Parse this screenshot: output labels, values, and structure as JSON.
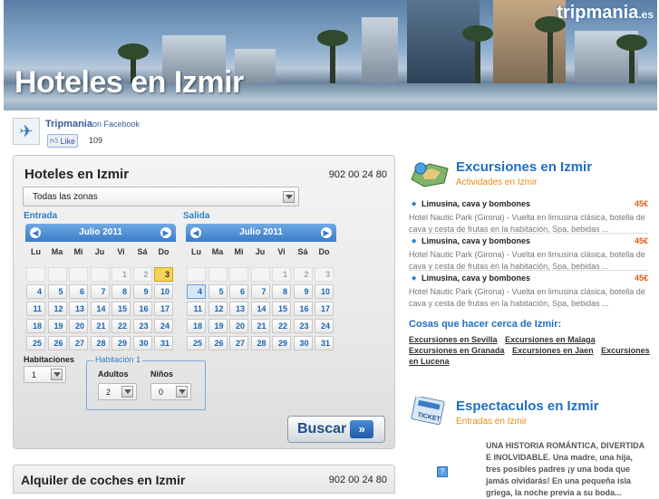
{
  "header": {
    "title": "Hoteles en Izmir",
    "logo_name": "tripmania",
    "logo_tld": ".es"
  },
  "facebook": {
    "page_name": "Tripmania",
    "on_text": "on Facebook",
    "like_label": "Like",
    "like_count": "109"
  },
  "hotels": {
    "title": "Hoteles en Izmir",
    "phone": "902 00 24 80",
    "zone_value": "Todas las zonas",
    "entrada_label": "Entrada",
    "salida_label": "Salida",
    "weekdays": [
      "Lu",
      "Ma",
      "Mi",
      "Ju",
      "Vi",
      "Sá",
      "Do"
    ],
    "cal_entrada": {
      "month": "Julio 2011",
      "weeks": [
        [
          "",
          "",
          "",
          "",
          "1",
          "2",
          "3"
        ],
        [
          "4",
          "5",
          "6",
          "7",
          "8",
          "9",
          "10"
        ],
        [
          "11",
          "12",
          "13",
          "14",
          "15",
          "16",
          "17"
        ],
        [
          "18",
          "19",
          "20",
          "21",
          "22",
          "23",
          "24"
        ],
        [
          "25",
          "26",
          "27",
          "28",
          "29",
          "30",
          "31"
        ]
      ],
      "today": "3"
    },
    "cal_salida": {
      "month": "Julio 2011",
      "weeks": [
        [
          "",
          "",
          "",
          "",
          "1",
          "2",
          "3"
        ],
        [
          "4",
          "5",
          "6",
          "7",
          "8",
          "9",
          "10"
        ],
        [
          "11",
          "12",
          "13",
          "14",
          "15",
          "16",
          "17"
        ],
        [
          "18",
          "19",
          "20",
          "21",
          "22",
          "23",
          "24"
        ],
        [
          "25",
          "26",
          "27",
          "28",
          "29",
          "30",
          "31"
        ]
      ],
      "selected": "4"
    },
    "habitaciones_label": "Habitaciones",
    "habitaciones_value": "1",
    "habitacion1_label": "Habitación 1",
    "adultos_label": "Adultos",
    "adultos_value": "2",
    "ninos_label": "Niños",
    "ninos_value": "0",
    "search_label": "Buscar"
  },
  "cars": {
    "title": "Alquiler de coches en Izmir",
    "phone": "902 00 24 80"
  },
  "excursions": {
    "title": "Excursiones en Izmir",
    "subtitle": "Actividades en Izmir",
    "items": [
      {
        "name": "Limusina, cava y bombones",
        "price": "45€",
        "desc": "Hotel Nautic Park (Girona) - Vuelta en limusina clásica, botella de cava y cesta de frutas en la habitación, Spa, bebidas ..."
      },
      {
        "name": "Limusina, cava y bombones",
        "price": "45€",
        "desc": "Hotel Nautic Park (Girona) - Vuelta en limusina clásica, botella de cava y cesta de frutas en la habitación, Spa, bebidas ..."
      },
      {
        "name": "Limusina, cava y bombones",
        "price": "45€",
        "desc": "Hotel Nautic Park (Girona) - Vuelta en limusina clásica, botella de cava y cesta de frutas en la habitación, Spa, bebidas ..."
      }
    ]
  },
  "cosas": {
    "title": "Cosas que hacer cerca de Izmir:",
    "links": [
      "Excursiones en Sevilla",
      "Excursiones en Malaga",
      "Excursiones en Granada",
      "Excursiones en Jaen",
      "Excursiones en Lucena"
    ]
  },
  "shows": {
    "title": "Espectaculos en Izmir",
    "subtitle": "Entradas en Izmir",
    "ticket_text": "TICKET",
    "desc": "UNA HISTORIA ROMÁNTICA, DIVERTIDA E INOLVIDABLE. Una madre, una hija, tres posibles padres ¡y una boda que jamás olvidarás! En una pequeña isla griega, la noche previa a su boda...",
    "placeholder_icon": "?"
  },
  "colors": {
    "link_blue": "#1f6fbf",
    "accent_orange": "#e58a16",
    "price_red": "#e25b16",
    "today_yellow": "#f4d35b"
  }
}
